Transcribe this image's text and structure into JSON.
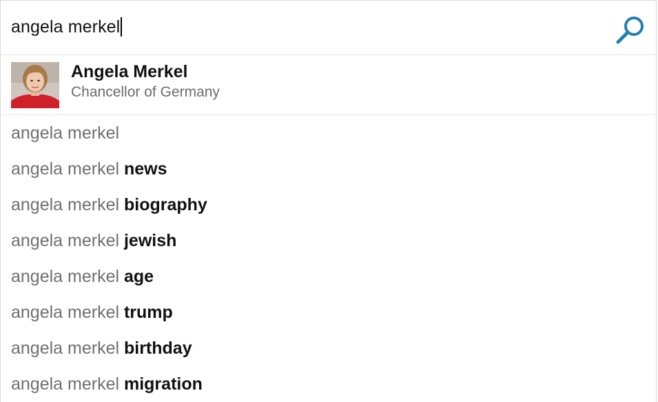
{
  "search": {
    "query": "angela merkel"
  },
  "entity": {
    "name": "Angela Merkel",
    "description": "Chancellor of Germany"
  },
  "suggestions": [
    {
      "prefix": "angela merkel",
      "completion": ""
    },
    {
      "prefix": "angela merkel ",
      "completion": "news"
    },
    {
      "prefix": "angela merkel ",
      "completion": "biography"
    },
    {
      "prefix": "angela merkel ",
      "completion": "jewish"
    },
    {
      "prefix": "angela merkel ",
      "completion": "age"
    },
    {
      "prefix": "angela merkel ",
      "completion": "trump"
    },
    {
      "prefix": "angela merkel ",
      "completion": "birthday"
    },
    {
      "prefix": "angela merkel ",
      "completion": "migration"
    }
  ],
  "colors": {
    "accent": "#1f7fb0",
    "suggestion_prefix": "#6f6f6f",
    "suggestion_completion": "#111111"
  },
  "icons": {
    "search": "search-icon"
  }
}
